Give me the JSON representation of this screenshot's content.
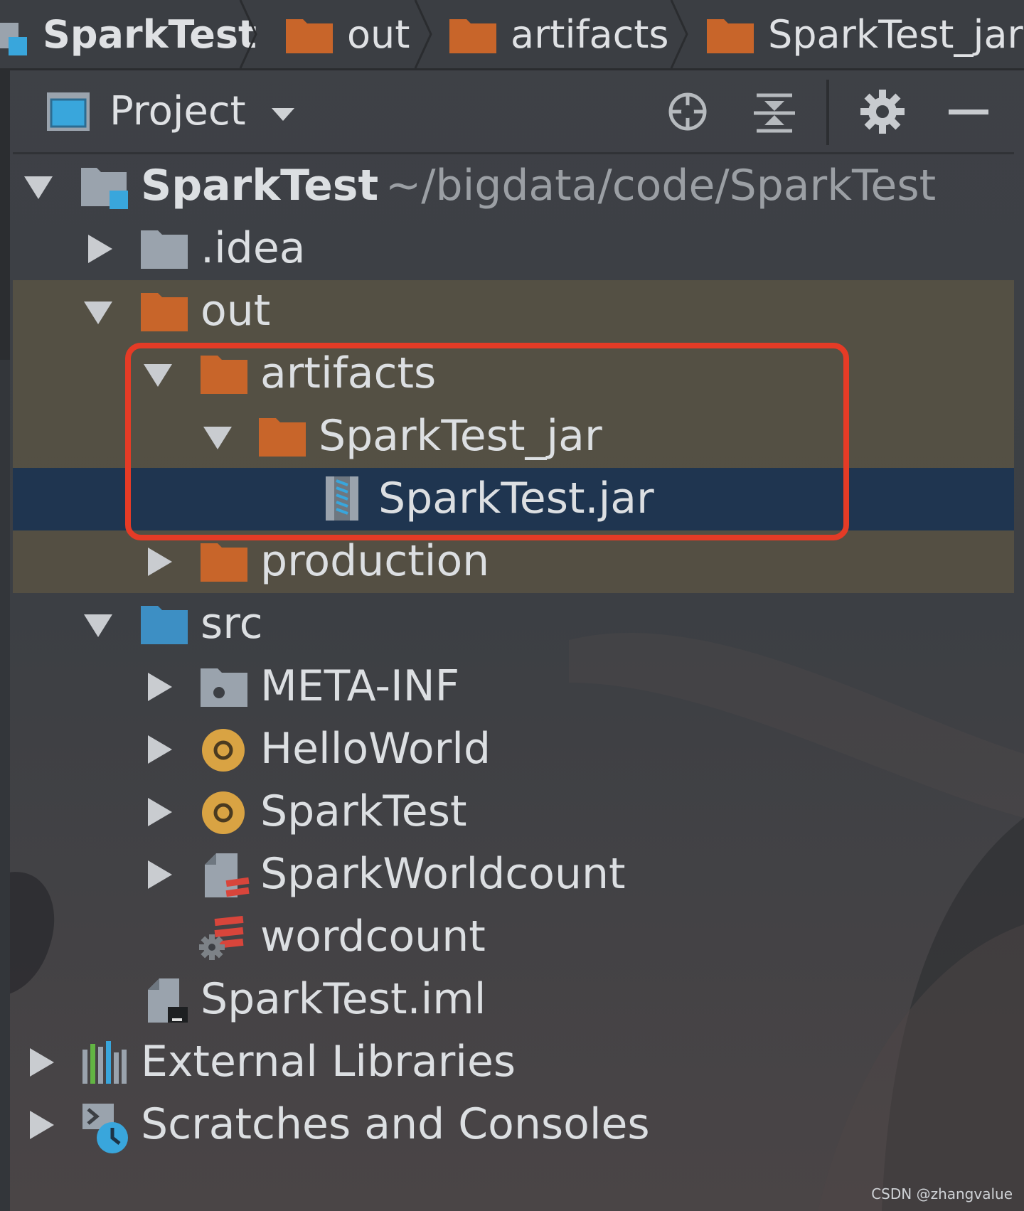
{
  "breadcrumb": [
    {
      "label": "SparkTest",
      "icon": "module-icon"
    },
    {
      "label": "out",
      "icon": "folder-icon"
    },
    {
      "label": "artifacts",
      "icon": "folder-icon"
    },
    {
      "label": "SparkTest_jar",
      "icon": "folder-icon"
    }
  ],
  "toolwindow": {
    "title": "Project",
    "buttons": [
      "locate-icon",
      "collapse-all-icon",
      "gear-icon",
      "minimize-icon"
    ]
  },
  "tree": {
    "root_name": "SparkTest",
    "root_path": "~/bigdata/code/SparkTest",
    "items": [
      {
        "label": ".idea",
        "icon": "folder-icon"
      },
      {
        "label": "out",
        "icon": "folder-icon"
      },
      {
        "label": "artifacts",
        "icon": "folder-icon"
      },
      {
        "label": "SparkTest_jar",
        "icon": "folder-icon"
      },
      {
        "label": "SparkTest.jar",
        "icon": "jar-file-icon"
      },
      {
        "label": "production",
        "icon": "folder-icon"
      },
      {
        "label": "src",
        "icon": "source-folder-icon"
      },
      {
        "label": "META-INF",
        "icon": "meta-folder-icon"
      },
      {
        "label": "HelloWorld",
        "icon": "scala-object-icon"
      },
      {
        "label": "SparkTest",
        "icon": "scala-object-icon"
      },
      {
        "label": "SparkWorldcount",
        "icon": "scala-file-icon"
      },
      {
        "label": "wordcount",
        "icon": "scala-runnable-icon"
      },
      {
        "label": "SparkTest.iml",
        "icon": "iml-file-icon"
      },
      {
        "label": "External Libraries",
        "icon": "libraries-icon"
      },
      {
        "label": "Scratches and Consoles",
        "icon": "scratches-icon"
      }
    ]
  },
  "watermark": "CSDN @zhangvalue",
  "colors": {
    "folder_orange": "#c8652a",
    "src_blue": "#3d8fc4",
    "selection": "#1f3550",
    "highlight_box": "#e53b26"
  }
}
